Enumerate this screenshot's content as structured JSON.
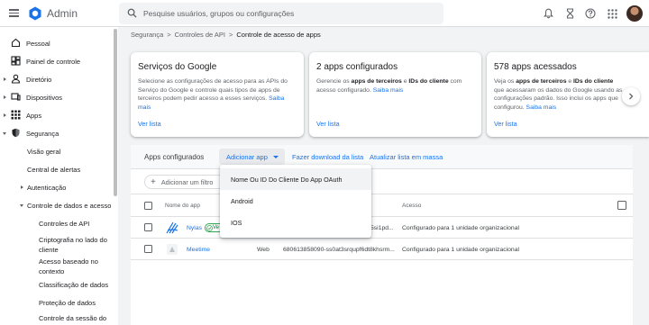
{
  "header": {
    "app_title": "Admin",
    "search_placeholder": "Pesquise usuários, grupos ou configurações",
    "icons": [
      "menu-icon",
      "admin-logo",
      "search-icon",
      "bell-icon",
      "hourglass-icon",
      "help-icon",
      "apps-grid-icon",
      "avatar"
    ]
  },
  "sidebar": {
    "items": [
      {
        "label": "Pessoal",
        "icon": "home-icon"
      },
      {
        "label": "Painel de controle",
        "icon": "dashboard-icon"
      },
      {
        "label": "Diretório",
        "icon": "person-icon"
      },
      {
        "label": "Dispositivos",
        "icon": "devices-icon"
      },
      {
        "label": "Apps",
        "icon": "apps-grid-icon"
      },
      {
        "label": "Segurança",
        "icon": "shield-icon"
      },
      {
        "label": "Visão geral"
      },
      {
        "label": "Central de alertas"
      },
      {
        "label": "Autenticação"
      },
      {
        "label": "Controle de dados e acesso"
      },
      {
        "label": "Controles de API"
      },
      {
        "label": "Criptografia no lado do cliente"
      },
      {
        "label": "Acesso baseado no contexto"
      },
      {
        "label": "Classificação de dados"
      },
      {
        "label": "Proteção de dados"
      },
      {
        "label": "Controle da sessão do"
      }
    ]
  },
  "breadcrumb": {
    "items": [
      "Segurança",
      "Controles de API",
      "Controle de acesso de apps"
    ],
    "separator": ">"
  },
  "cards": [
    {
      "title": "Serviços do Google",
      "desc_parts": [
        "Selecione as configurações de acesso para as APIs do Serviço do Google e controle quais tipos de apps de terceiros podem pedir acesso a esses serviços. ",
        "Saiba mais"
      ],
      "view": "Ver lista"
    },
    {
      "title": "2 apps configurados",
      "desc_parts": [
        "Gerencie os ",
        "apps de terceiros",
        " e ",
        "IDs do cliente",
        " com acesso configurado. ",
        "Saiba mais"
      ],
      "view": "Ver lista"
    },
    {
      "title": "578 apps acessados",
      "desc_parts": [
        "Veja os ",
        "apps de terceiros",
        " e ",
        "IDs do cliente",
        " que acessaram os dados do Google usando as configurações padrão. Isso inclui os apps que configurou. ",
        "Saiba mais"
      ],
      "view": "Ver lista"
    }
  ],
  "panel": {
    "title": "Apps configurados",
    "add_app": "Adicionar app",
    "download": "Fazer download da lista",
    "bulk_update": "Atualizar lista em massa",
    "filter": "Adicionar um filtro",
    "columns": [
      "Nome do app",
      "Acesso"
    ],
    "rows": [
      {
        "name": "Nylas",
        "badge": "Ve",
        "type": "",
        "id": "5si1pd...",
        "access": "Configurado para 1 unidade organizacional"
      },
      {
        "name": "Meetime",
        "badge": "",
        "type": "Web",
        "id": "680613858090-ss0at3srqupf6dt8khsrm...",
        "access": "Configurado para 1 unidade organizacional"
      }
    ]
  },
  "dropdown": {
    "items": [
      "Nome Ou ID Do Cliente Do App OAuth",
      "Android",
      "IOS"
    ]
  },
  "colors": {
    "accent": "#1a73e8",
    "background": "#f1f3f4",
    "highlight": "#f1f3f4",
    "verified": "#34a853"
  }
}
